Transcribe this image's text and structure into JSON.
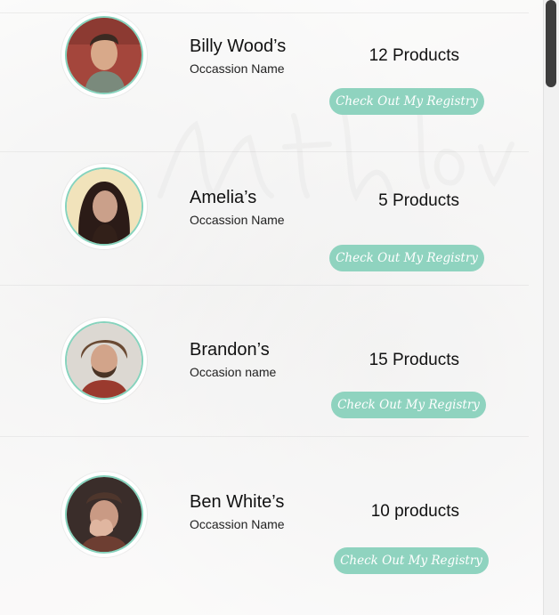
{
  "registries": [
    {
      "name": "Billy Wood’s",
      "occasion": "Occassion Name",
      "count": "12 Products",
      "button": "Check Out My Registry",
      "avatar": "man-portrait-avatar"
    },
    {
      "name": "Amelia’s",
      "occasion": "Occassion Name",
      "count": "5 Products",
      "button": "Check Out My Registry",
      "avatar": "woman-portrait-avatar"
    },
    {
      "name": "Brandon’s",
      "occasion": "Occasion name",
      "count": "15 Products",
      "button": "Check Out My Registry",
      "avatar": "bearded-man-avatar"
    },
    {
      "name": "Ben White’s",
      "occasion": "Occassion Name",
      "count": "10 products",
      "button": "Check Out My Registry",
      "avatar": "man-hands-face-avatar"
    }
  ],
  "colors": {
    "accent": "#8fd3bf",
    "avatar_ring": "#86d3bd",
    "text": "#111111"
  }
}
